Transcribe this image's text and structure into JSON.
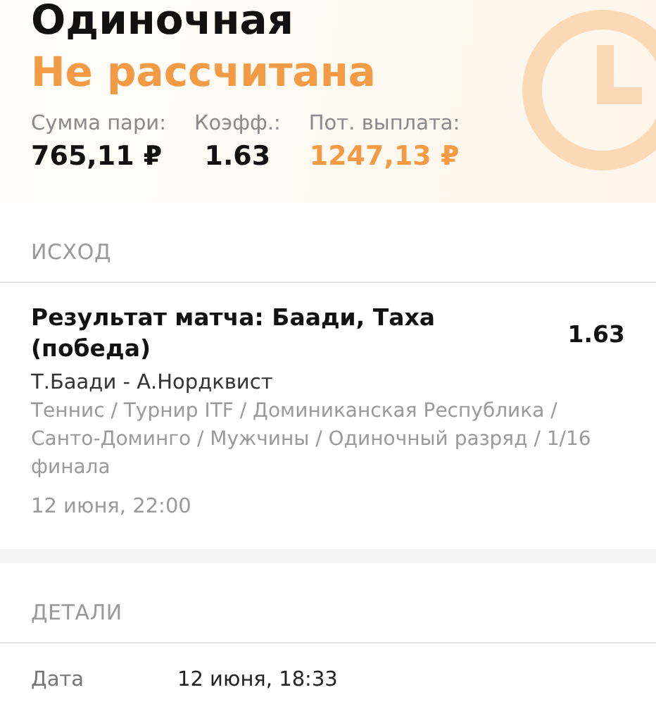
{
  "header": {
    "title": "Одиночная",
    "status": "Не рассчитана",
    "stats": [
      {
        "label": "Сумма пари:",
        "value": "765,11 ₽",
        "kind": "plain"
      },
      {
        "label": "Коэфф.:",
        "value": "1.63",
        "kind": "plain"
      },
      {
        "label": "Пот. выплата:",
        "value": "1247,13 ₽",
        "kind": "accent"
      }
    ]
  },
  "outcome": {
    "heading": "ИСХОД",
    "market": "Результат матча: Баади, Таха (победа)",
    "odds": "1.63",
    "match": "Т.Баади - А.Нордквист",
    "path": "Теннис / Турнир ITF / Доминиканская Республика / Санто-Доминго / Мужчины / Одиночный разряд / 1/16 финала",
    "time": "12 июня, 22:00"
  },
  "details": {
    "heading": "ДЕТАЛИ",
    "rows": [
      {
        "label": "Дата",
        "value": "12 июня, 18:33"
      }
    ]
  }
}
